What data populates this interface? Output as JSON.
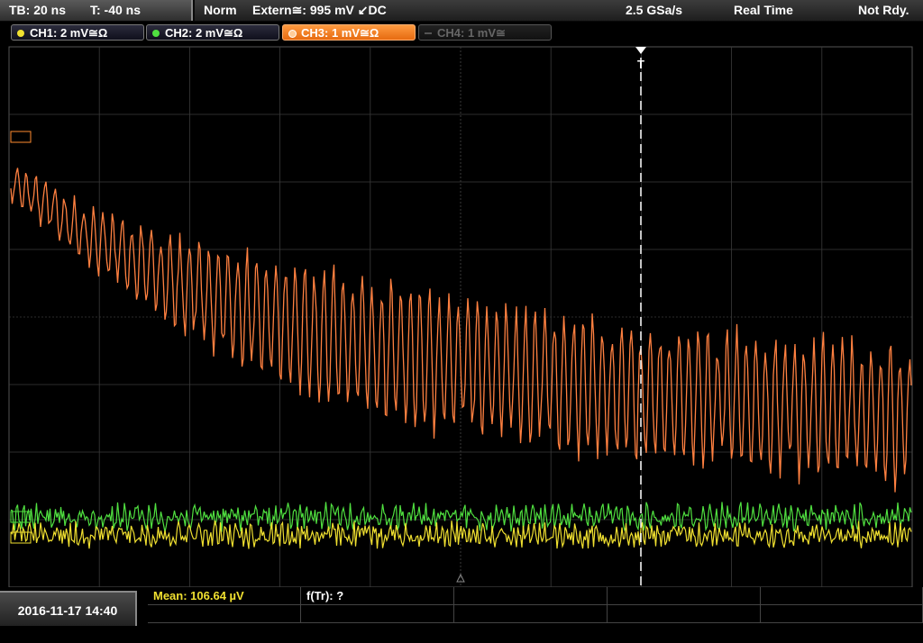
{
  "topbar": {
    "timebase": "TB: 20 ns",
    "trigger_offset": "T: -40 ns",
    "mode": "Norm",
    "trigger_source": "Extern≅: 995 mV ↙DC",
    "sample_rate": "2.5 GSa/s",
    "acq_mode": "Real Time",
    "run_state": "Not Rdy."
  },
  "channels": [
    {
      "label": "CH1: 2 mV≅Ω",
      "color": "#f0e030",
      "state": "on"
    },
    {
      "label": "CH2: 2 mV≅Ω",
      "color": "#50e040",
      "state": "on"
    },
    {
      "label": "CH3: 1 mV≅Ω",
      "color": "#ff8c30",
      "state": "active"
    },
    {
      "label": "CH4: 1 mV≅",
      "color": "#666666",
      "state": "off"
    }
  ],
  "trigger_marker": "T",
  "bottombar": {
    "datetime": "2016-11-17 14:40",
    "measurement_1": "Mean: 106.64 µV",
    "measurement_2": "f(Tr): ?"
  },
  "colors": {
    "ch1": "#f0e030",
    "ch2": "#50e040",
    "ch3": "#ff8040",
    "grid": "#3a3a3a",
    "trigger_line": "#ffffff"
  }
}
